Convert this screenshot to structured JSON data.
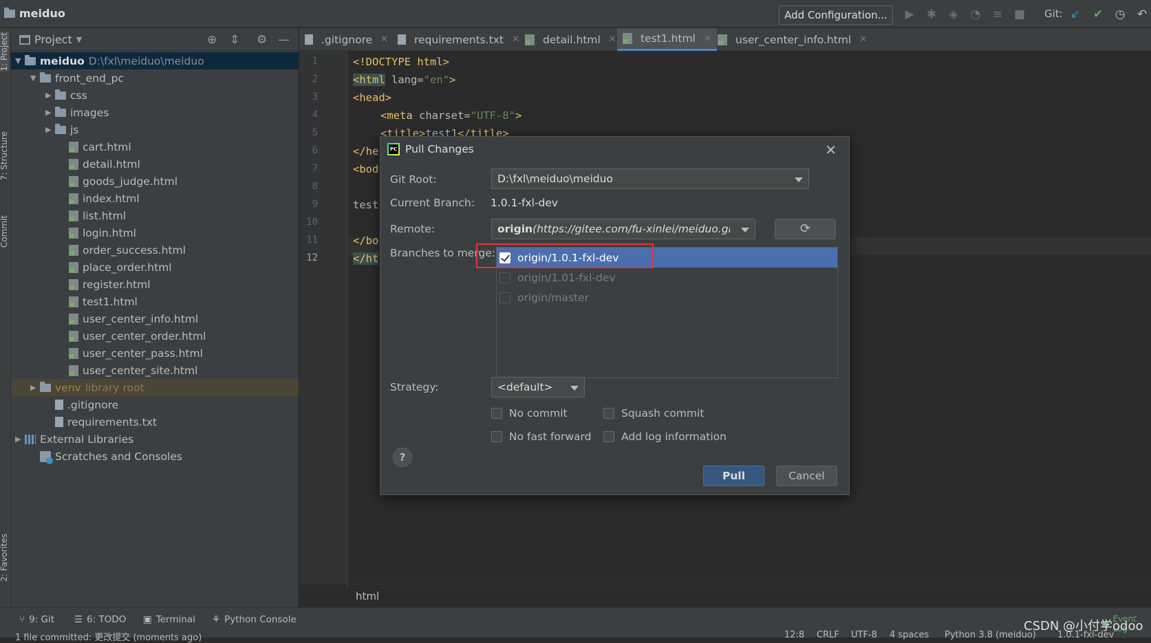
{
  "topbar": {
    "project": "meiduo",
    "add_config": "Add Configuration...",
    "git_label": "Git:"
  },
  "leftstrip": {
    "project": "1: Project",
    "structure": "7: Structure",
    "commit": "Commit",
    "favorites": "2: Favorites"
  },
  "panel": {
    "title": "Project"
  },
  "tree": [
    {
      "label": "meiduo",
      "extra": "D:\\fxl\\meiduo\\meiduo",
      "icon": "folder-icon",
      "arrow": "▼"
    },
    {
      "label": "front_end_pc",
      "icon": "folder-icon",
      "arrow": "▼"
    },
    {
      "label": "css",
      "icon": "folder-icon",
      "arrow": "▶"
    },
    {
      "label": "images",
      "icon": "folder-icon",
      "arrow": "▶"
    },
    {
      "label": "js",
      "icon": "folder-icon",
      "arrow": "▶"
    },
    {
      "label": "cart.html",
      "icon": "html-file-icon"
    },
    {
      "label": "detail.html",
      "icon": "html-file-icon"
    },
    {
      "label": "goods_judge.html",
      "icon": "html-file-icon"
    },
    {
      "label": "index.html",
      "icon": "html-file-icon"
    },
    {
      "label": "list.html",
      "icon": "html-file-icon"
    },
    {
      "label": "login.html",
      "icon": "html-file-icon"
    },
    {
      "label": "order_success.html",
      "icon": "html-file-icon"
    },
    {
      "label": "place_order.html",
      "icon": "html-file-icon"
    },
    {
      "label": "register.html",
      "icon": "html-file-icon"
    },
    {
      "label": "test1.html",
      "icon": "html-file-icon"
    },
    {
      "label": "user_center_info.html",
      "icon": "html-file-icon"
    },
    {
      "label": "user_center_order.html",
      "icon": "html-file-icon"
    },
    {
      "label": "user_center_pass.html",
      "icon": "html-file-icon"
    },
    {
      "label": "user_center_site.html",
      "icon": "html-file-icon"
    },
    {
      "label": "venv",
      "extra": "library root",
      "icon": "folder-icon",
      "arrow": "▶"
    },
    {
      "label": ".gitignore",
      "icon": "file-icon"
    },
    {
      "label": "requirements.txt",
      "icon": "file-icon"
    },
    {
      "label": "External Libraries",
      "icon": "library-icon",
      "arrow": "▶"
    },
    {
      "label": "Scratches and Consoles",
      "icon": "scratch-icon"
    }
  ],
  "tabs": [
    {
      "label": ".gitignore"
    },
    {
      "label": "requirements.txt"
    },
    {
      "label": "detail.html"
    },
    {
      "label": "test1.html"
    },
    {
      "label": "user_center_info.html"
    }
  ],
  "lines": [
    "1",
    "2",
    "3",
    "4",
    "5",
    "6",
    "7",
    "8",
    "9",
    "10",
    "11",
    "12"
  ],
  "code": {
    "l1": "<!DOCTYPE html>",
    "l2_tag": "<html",
    "l2_attr": " lang=",
    "l2_val": "\"en\"",
    "l2_end": ">",
    "l3": "<head>",
    "l4_tag": "<meta",
    "l4_attr": " charset=",
    "l4_val": "\"UTF-8\"",
    "l4_end": ">",
    "l5_open": "<title>",
    "l5_text": "test1",
    "l5_close": "</title>",
    "l6": "</he",
    "l7": "<bod",
    "l9": "test",
    "l11": "</bo",
    "l12": "</ht"
  },
  "breadcrumb": "html",
  "dialog": {
    "title": "Pull Changes",
    "git_root_label": "Git Root:",
    "git_root_value": "D:\\fxl\\meiduo\\meiduo",
    "branch_label": "Current Branch:",
    "branch_value": "1.0.1-fxl-dev",
    "remote_label": "Remote:",
    "remote_name": "origin",
    "remote_url": "(https://gitee.com/fu-xinlei/meiduo.git)",
    "branches_label": "Branches to merge:",
    "branches": [
      {
        "label": "origin/1.0.1-fxl-dev",
        "checked": true
      },
      {
        "label": "origin/1.01-fxl-dev",
        "checked": false
      },
      {
        "label": "origin/master",
        "checked": false
      }
    ],
    "strategy_label": "Strategy:",
    "strategy_value": "<default>",
    "opt_no_commit": "No commit",
    "opt_squash": "Squash commit",
    "opt_no_ff": "No fast forward",
    "opt_log": "Add log information",
    "help": "?",
    "pull": "Pull",
    "cancel": "Cancel"
  },
  "bottom": {
    "git": "9: Git",
    "todo": "6: TODO",
    "terminal": "Terminal",
    "python_console": "Python Console",
    "status_left": "1 file committed: 更改提交 (moments ago)",
    "status_pos": "12:8",
    "status_crlf": "CRLF",
    "status_enc": "UTF-8",
    "status_indent": "4 spaces",
    "status_interp": "Python 3.8 (meiduo)",
    "status_branch": "1.0.1-fxl-dev",
    "event_log": "Event Log",
    "watermark": "CSDN @小付学odoo"
  },
  "colors": {
    "accent": "#4b6eaf",
    "highlight": "#e8323a",
    "tag": "#e8bf6a",
    "string": "#6a8759"
  }
}
